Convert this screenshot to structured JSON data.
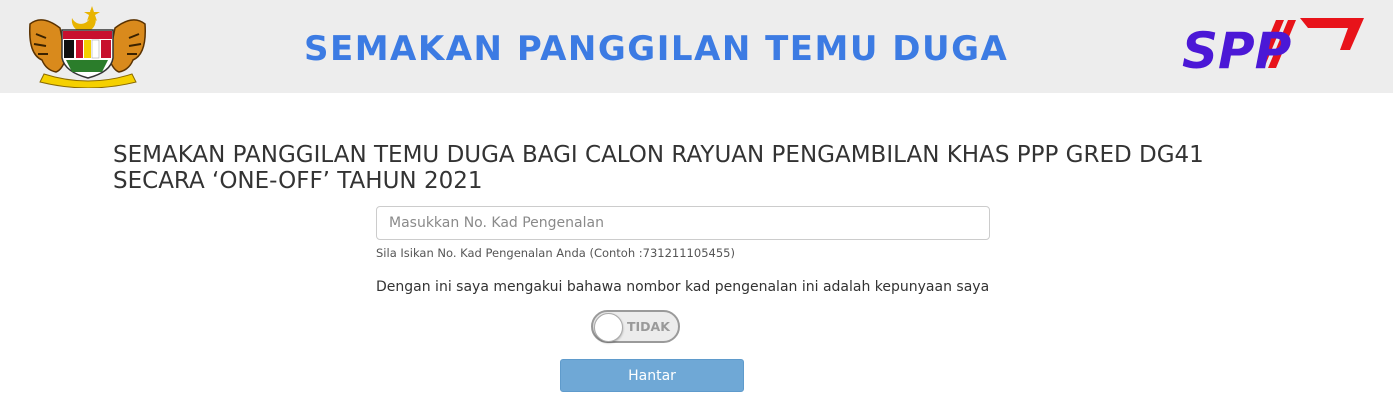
{
  "header": {
    "banner_title": "SEMAKAN PANGGILAN TEMU DUGA",
    "logo_text": "SPP",
    "colors": {
      "header_bg": "#ededed",
      "title": "#3c7be3",
      "logo_blue": "#4b18d6",
      "logo_red": "#e8131a"
    }
  },
  "main": {
    "heading": "SEMAKAN PANGGILAN TEMU DUGA BAGI CALON RAYUAN PENGAMBILAN KHAS PPP GRED DG41 SECARA ‘ONE-OFF’ TAHUN 2021",
    "ic_input": {
      "placeholder": "Masukkan No. Kad Pengenalan",
      "value": ""
    },
    "help_text": "Sila Isikan No. Kad Pengenalan Anda (Contoh :731211105455)",
    "declaration": "Dengan ini saya mengakui bahawa nombor kad pengenalan ini adalah kepunyaan saya",
    "toggle": {
      "label": "TIDAK",
      "state": "off"
    },
    "submit_label": "Hantar",
    "colors": {
      "button_bg": "#6fa8d6"
    }
  }
}
